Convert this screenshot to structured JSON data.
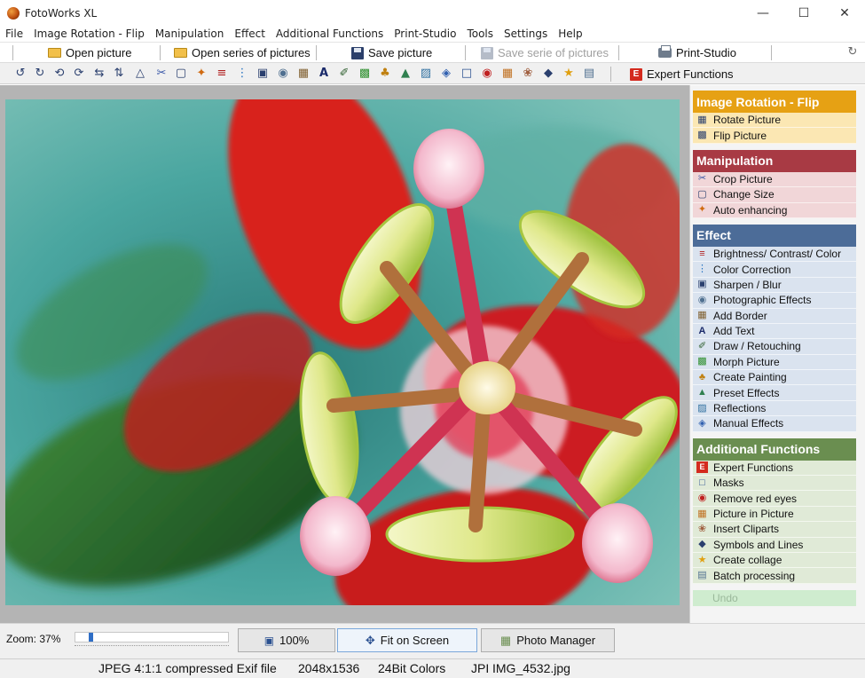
{
  "window": {
    "title": "FotoWorks XL",
    "controls": [
      "minimize-icon",
      "maximize-icon",
      "close-icon"
    ]
  },
  "menu": [
    {
      "label": "File"
    },
    {
      "label": "Image Rotation - Flip"
    },
    {
      "label": "Manipulation"
    },
    {
      "label": "Effect"
    },
    {
      "label": "Additional Functions"
    },
    {
      "label": "Print-Studio"
    },
    {
      "label": "Tools"
    },
    {
      "label": "Settings"
    },
    {
      "label": "Help"
    }
  ],
  "toolbar": {
    "open_picture": "Open picture",
    "open_series": "Open series of pictures",
    "save_picture": "Save picture",
    "save_series": "Save serie of pictures",
    "print_studio": "Print-Studio"
  },
  "icon_toolbar": {
    "expert_functions": "Expert Functions",
    "expert_badge": "E"
  },
  "panel": {
    "groups": [
      {
        "title": "Image Rotation - Flip",
        "items": [
          {
            "label": "Rotate Picture",
            "icon": "rotate-icon"
          },
          {
            "label": "Flip Picture",
            "icon": "flip-icon"
          }
        ]
      },
      {
        "title": "Manipulation",
        "items": [
          {
            "label": "Crop Picture",
            "icon": "scissors-icon"
          },
          {
            "label": "Change Size",
            "icon": "resize-icon"
          },
          {
            "label": "Auto enhancing",
            "icon": "magic-wand-icon"
          }
        ]
      },
      {
        "title": "Effect",
        "items": [
          {
            "label": "Brightness/ Contrast/ Color",
            "icon": "sliders-icon"
          },
          {
            "label": "Color Correction",
            "icon": "color-sliders-icon"
          },
          {
            "label": "Sharpen / Blur",
            "icon": "sharpen-icon"
          },
          {
            "label": "Photographic Effects",
            "icon": "camera-icon"
          },
          {
            "label": "Add Border",
            "icon": "frame-icon"
          },
          {
            "label": "Add Text",
            "icon": "text-icon"
          },
          {
            "label": "Draw / Retouching",
            "icon": "brush-icon"
          },
          {
            "label": "Morph Picture",
            "icon": "morph-icon"
          },
          {
            "label": "Create Painting",
            "icon": "paint-icon"
          },
          {
            "label": "Preset Effects",
            "icon": "preset-icon"
          },
          {
            "label": "Reflections",
            "icon": "reflection-icon"
          },
          {
            "label": "Manual Effects",
            "icon": "manual-icon"
          }
        ]
      },
      {
        "title": "Additional Functions",
        "items": [
          {
            "label": "Expert Functions",
            "icon": "expert-icon"
          },
          {
            "label": "Masks",
            "icon": "mask-icon"
          },
          {
            "label": "Remove red eyes",
            "icon": "eye-icon"
          },
          {
            "label": "Picture in Picture",
            "icon": "picture-icon"
          },
          {
            "label": "Insert Cliparts",
            "icon": "clipart-icon"
          },
          {
            "label": "Symbols and Lines",
            "icon": "symbols-icon"
          },
          {
            "label": "Create collage",
            "icon": "star-icon"
          },
          {
            "label": "Batch processing",
            "icon": "batch-icon"
          }
        ]
      }
    ],
    "undo": "Undo"
  },
  "bottom": {
    "zoom_label": "Zoom: 37%",
    "zoom_percent": 37,
    "btn_100": "100%",
    "btn_fit": "Fit on Screen",
    "btn_manager": "Photo Manager"
  },
  "status": {
    "format": "JPEG 4:1:1 compressed Exif file",
    "dimensions": "2048x1536",
    "colors": "24Bit Colors",
    "ext": "JPI",
    "filename": "IMG_4532.jpg"
  }
}
